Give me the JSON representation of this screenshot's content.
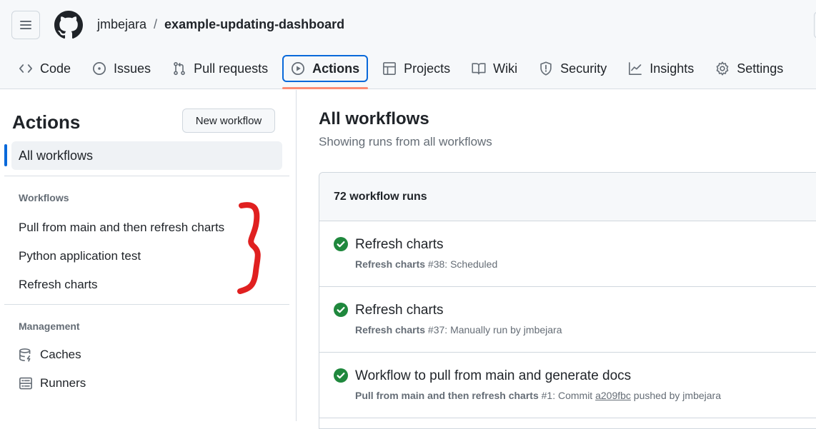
{
  "header": {
    "owner": "jmbejara",
    "separator": "/",
    "repo": "example-updating-dashboard"
  },
  "tabs": [
    {
      "label": "Code",
      "icon": "code-icon"
    },
    {
      "label": "Issues",
      "icon": "issue-opened-icon"
    },
    {
      "label": "Pull requests",
      "icon": "git-pull-request-icon"
    },
    {
      "label": "Actions",
      "icon": "play-icon",
      "active": true
    },
    {
      "label": "Projects",
      "icon": "table-icon"
    },
    {
      "label": "Wiki",
      "icon": "book-icon"
    },
    {
      "label": "Security",
      "icon": "shield-icon"
    },
    {
      "label": "Insights",
      "icon": "graph-icon"
    },
    {
      "label": "Settings",
      "icon": "gear-icon"
    }
  ],
  "sidebar": {
    "title": "Actions",
    "new_workflow_label": "New workflow",
    "all_workflows_label": "All workflows",
    "workflows_heading": "Workflows",
    "workflows": [
      "Pull from main and then refresh charts",
      "Python application test",
      "Refresh charts"
    ],
    "management_heading": "Management",
    "management": [
      {
        "label": "Caches",
        "icon": "database-icon"
      },
      {
        "label": "Runners",
        "icon": "server-icon"
      }
    ]
  },
  "main": {
    "title": "All workflows",
    "subtitle": "Showing runs from all workflows",
    "runs_count_label": "72 workflow runs",
    "runs": [
      {
        "status": "success",
        "title": "Refresh charts",
        "workflow": "Refresh charts",
        "detail": " #38: Scheduled"
      },
      {
        "status": "success",
        "title": "Refresh charts",
        "workflow": "Refresh charts",
        "detail": " #37: Manually run by jmbejara"
      },
      {
        "status": "success",
        "title": "Workflow to pull from main and generate docs",
        "workflow": "Pull from main and then refresh charts",
        "detail_prefix": " #1: Commit ",
        "commit": "a209fbc",
        "detail_suffix": " pushed by jmbejara"
      }
    ]
  },
  "colors": {
    "accent": "#0969da",
    "tab_underline": "#fd8c73",
    "success": "#1f883d",
    "annotation": "#e02020"
  }
}
